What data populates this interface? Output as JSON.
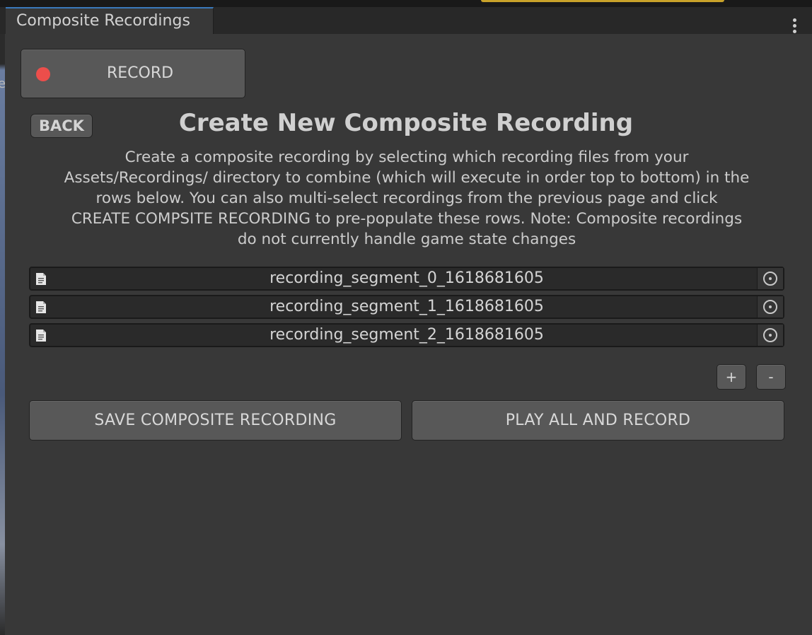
{
  "window": {
    "tab_title": "Composite Recordings",
    "menu_icon": "vertical-ellipsis-icon",
    "accent_color": "#3a79bb"
  },
  "left_edge_glyph": "e",
  "record_button": {
    "label": "RECORD",
    "dot_color": "#ec4e4b"
  },
  "back_button": {
    "label": "BACK"
  },
  "page": {
    "title": "Create New Composite Recording",
    "description_lines": [
      "Create a composite recording by selecting which recording files from your",
      "Assets/Recordings/ directory to combine (which will execute in order top to bottom) in the",
      "rows below.  You can also multi-select recordings from the previous page and click",
      "CREATE COMPSITE RECORDING to pre-populate these rows.  Note: Composite recordings",
      "do not currently handle game state changes"
    ]
  },
  "recordings": [
    {
      "name": "recording_segment_0_1618681605",
      "icon": "text-asset-icon",
      "picker_icon": "object-picker-icon"
    },
    {
      "name": "recording_segment_1_1618681605",
      "icon": "text-asset-icon",
      "picker_icon": "object-picker-icon"
    },
    {
      "name": "recording_segment_2_1618681605",
      "icon": "text-asset-icon",
      "picker_icon": "object-picker-icon"
    }
  ],
  "list_controls": {
    "add_label": "+",
    "remove_label": "-"
  },
  "actions": {
    "save_label": "SAVE COMPOSITE RECORDING",
    "play_label": "PLAY ALL AND RECORD"
  }
}
